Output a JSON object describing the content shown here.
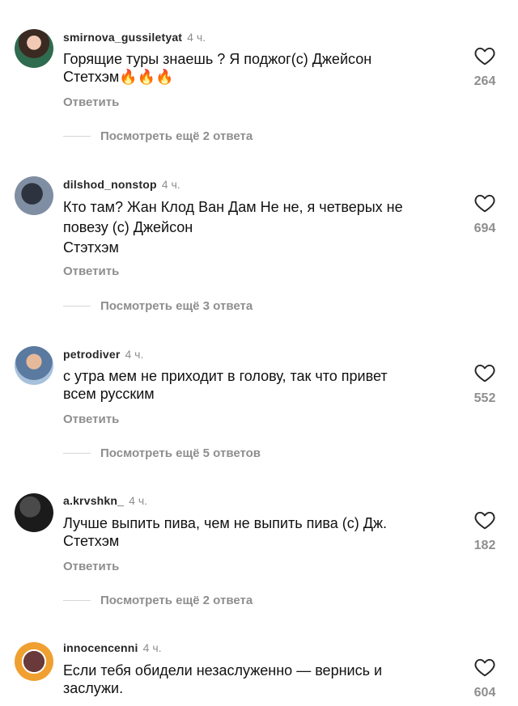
{
  "comments": [
    {
      "username": "smirnova_gussiletyat",
      "time": "4 ч.",
      "text": "Горящие туры знаешь ? Я поджог(с) Джейсон\nСтетхэм🔥🔥🔥",
      "reply_label": "Ответить",
      "likes": "264",
      "more_replies": "Посмотреть ещё 2 ответа"
    },
    {
      "username": "dilshod_nonstop",
      "time": "4 ч.",
      "text": "Кто там? Жан Клод Ван Дам Не не, я четверых не\nповезу (с) Джейсон\nСтэтхэм",
      "reply_label": "Ответить",
      "likes": "694",
      "more_replies": "Посмотреть ещё 3 ответа"
    },
    {
      "username": "petrodiver",
      "time": "4 ч.",
      "text": "с утра мем не приходит в голову, так что привет\nвсем русским",
      "reply_label": "Ответить",
      "likes": "552",
      "more_replies": "Посмотреть ещё 5 ответов"
    },
    {
      "username": "a.krvshkn_",
      "time": "4 ч.",
      "text": "Лучше выпить пива, чем не выпить пива (с) Дж.\nСтетхэм",
      "reply_label": "Ответить",
      "likes": "182",
      "more_replies": "Посмотреть ещё 2 ответа"
    },
    {
      "username": "innocencenni",
      "time": "4 ч.",
      "text": "Если тебя обидели незаслуженно — вернись и\nзаслужи.",
      "likes": "604"
    }
  ],
  "icons": {
    "like": "heart-outline-icon"
  },
  "colors": {
    "muted": "#8e8e8e",
    "text": "#111111"
  }
}
